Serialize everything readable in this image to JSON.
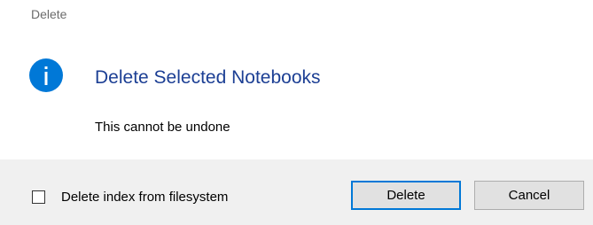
{
  "window": {
    "title": "Delete"
  },
  "dialog": {
    "icon": "info-icon",
    "icon_color": "#0078d7",
    "heading": "Delete Selected Notebooks",
    "heading_color": "#1c3f94",
    "message": "This cannot be undone"
  },
  "footer": {
    "checkbox_label": "Delete index from filesystem",
    "checkbox_checked": false,
    "delete_label": "Delete",
    "cancel_label": "Cancel",
    "default_button_border": "#0078d7",
    "background": "#f0f0f0"
  }
}
